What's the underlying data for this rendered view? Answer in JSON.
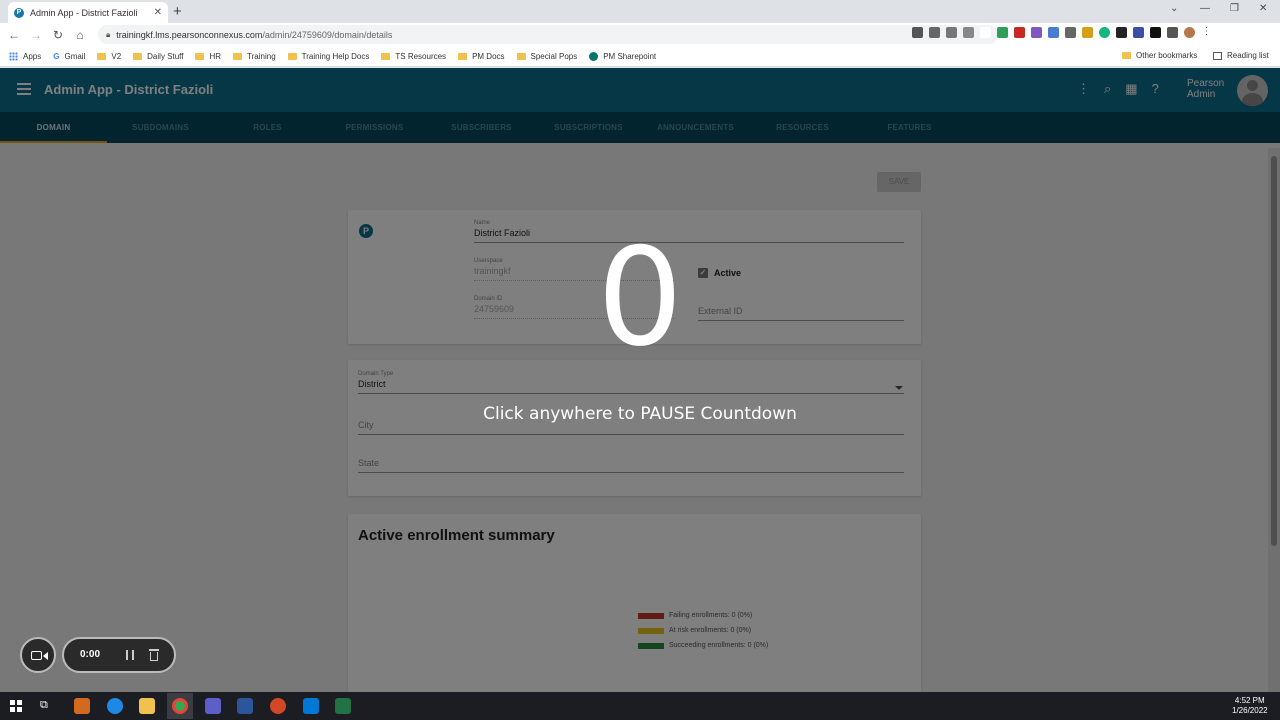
{
  "browser": {
    "tab_title": "Admin App - District Fazioli",
    "url_host": "trainingkf.lms.pearsonconnexus.com",
    "url_path": "/admin/24759609/domain/details",
    "bookmarks": [
      "Apps",
      "Gmail",
      "V2",
      "Daily Stuff",
      "HR",
      "Training",
      "Training Help Docs",
      "TS Resources",
      "PM Docs",
      "Special Pops",
      "PM Sharepoint"
    ],
    "other_bookmarks": "Other bookmarks",
    "reading_list": "Reading list"
  },
  "app": {
    "title": "Admin App - District Fazioli",
    "user_line1": "Pearson",
    "user_line2": "Admin",
    "tabs": [
      "DOMAIN",
      "SUBDOMAINS",
      "ROLES",
      "PERMISSIONS",
      "SUBSCRIBERS",
      "SUBSCRIPTIONS",
      "ANNOUNCEMENTS",
      "RESOURCES",
      "FEATURES"
    ],
    "active_tab": "DOMAIN",
    "save_label": "SAVE"
  },
  "domain_card": {
    "name_label": "Name",
    "name_value": "District Fazioli",
    "userspace_label": "Userspace",
    "userspace_value": "trainingkf",
    "domain_id_label": "Domain ID",
    "domain_id_value": "24759609",
    "active_label": "Active",
    "external_id_placeholder": "External ID"
  },
  "location_card": {
    "domain_type_label": "Domain Type",
    "domain_type_value": "District",
    "city_placeholder": "City",
    "state_placeholder": "State"
  },
  "enrollment_card": {
    "title": "Active enrollment summary",
    "legend": [
      {
        "label": "Failing enrollments: 0 (0%)",
        "color": "#c0392b"
      },
      {
        "label": "At risk enrollments: 0 (0%)",
        "color": "#e6c619"
      },
      {
        "label": "Succeeding enrollments: 0 (0%)",
        "color": "#2e8b3a"
      }
    ]
  },
  "overlay": {
    "countdown": "0",
    "message": "Click anywhere to PAUSE Countdown",
    "timer": "0:00"
  },
  "taskbar": {
    "time": "4:52 PM",
    "date": "1/26/2022"
  }
}
